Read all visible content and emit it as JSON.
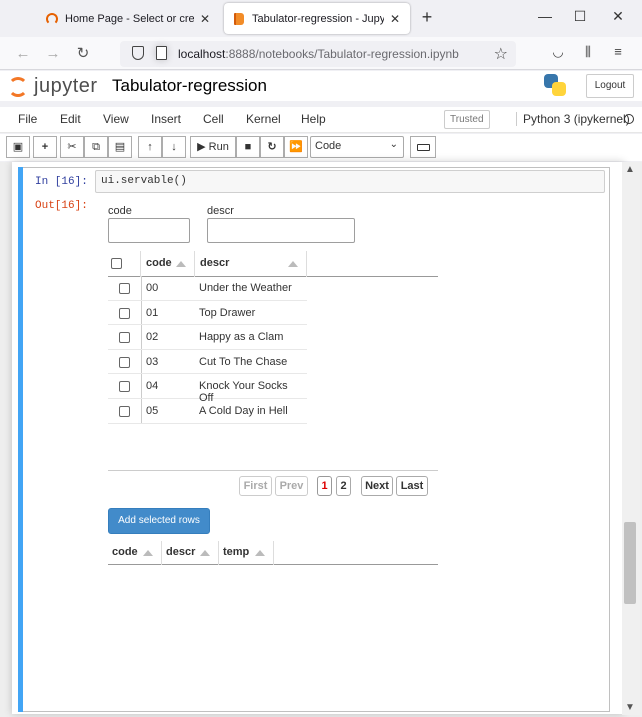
{
  "browser": {
    "tabs": [
      {
        "title": "Home Page - Select or create a",
        "active": false
      },
      {
        "title": "Tabulator-regression - Jupyter N",
        "active": true
      }
    ],
    "url_host": "localhost",
    "url_path": ":8888/notebooks/Tabulator-regression.ipynb"
  },
  "jupyter": {
    "logo_text": "jupyter",
    "notebook_title": "Tabulator-regression",
    "logout_label": "Logout",
    "menu": [
      "File",
      "Edit",
      "View",
      "Insert",
      "Cell",
      "Kernel",
      "Help"
    ],
    "trusted_label": "Trusted",
    "kernel_label": "Python 3 (ipykernel)",
    "toolbar": {
      "run_label": "Run",
      "cell_type": "Code"
    }
  },
  "cell": {
    "in_prompt": "In [16]:",
    "out_prompt": "Out[16]:",
    "source": "ui.servable()"
  },
  "widgets": {
    "code_label": "code",
    "descr_label": "descr"
  },
  "table1": {
    "columns": [
      "code",
      "descr"
    ],
    "rows": [
      {
        "code": "00",
        "descr": "Under the Weather"
      },
      {
        "code": "01",
        "descr": "Top Drawer"
      },
      {
        "code": "02",
        "descr": "Happy as a Clam"
      },
      {
        "code": "03",
        "descr": "Cut To The Chase"
      },
      {
        "code": "04",
        "descr": "Knock Your Socks Off"
      },
      {
        "code": "05",
        "descr": "A Cold Day in Hell"
      }
    ],
    "pager": {
      "first": "First",
      "prev": "Prev",
      "pages": [
        "1",
        "2"
      ],
      "current_page": "1",
      "next": "Next",
      "last": "Last"
    }
  },
  "add_button_label": "Add selected rows",
  "table2": {
    "columns": [
      "code",
      "descr",
      "temp"
    ]
  }
}
